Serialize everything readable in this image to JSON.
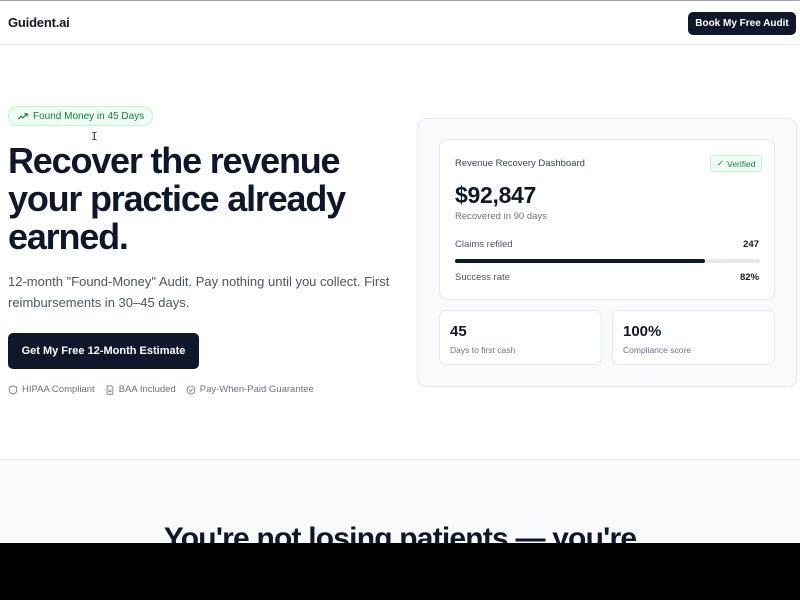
{
  "brand": {
    "logo": "Guident.ai"
  },
  "header": {
    "cta": "Book My Free Audit"
  },
  "hero": {
    "badge": "Found Money in 45 Days",
    "cursor": "I",
    "headline": [
      "Recover the revenue",
      "your practice already",
      "earned."
    ],
    "subcopy": "12-month \"Found-Money\" Audit. Pay nothing until you collect. First reimbursements in 30–45 days.",
    "cta": "Get My Free 12-Month Estimate",
    "trust": [
      "HIPAA Compliant",
      "BAA Included",
      "Pay-When-Paid Guarantee"
    ]
  },
  "dashboard": {
    "title": "Revenue Recovery Dashboard",
    "verified": "Verified",
    "amount": "$92,847",
    "amount_sub": "Recovered in 90 days",
    "claims_label": "Claims refiled",
    "claims_value": "247",
    "progress_fraction": 0.82,
    "success_label": "Success rate",
    "success_value": "82%"
  },
  "stats": [
    {
      "value": "45",
      "label": "Days to first cash"
    },
    {
      "value": "100%",
      "label": "Compliance score"
    }
  ],
  "section2": {
    "title": "You're not losing patients — you're"
  },
  "colors": {
    "primary": "#0f172a",
    "accent_green": "#15803d"
  }
}
